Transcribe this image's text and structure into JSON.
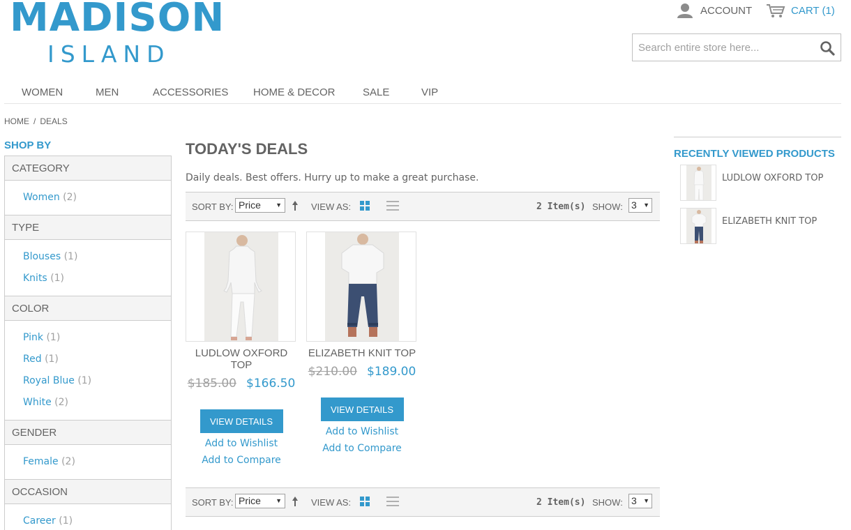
{
  "logo": {
    "main": "MADISON",
    "sub": "ISLAND"
  },
  "header": {
    "account_label": "ACCOUNT",
    "cart_label": "CART (1)",
    "search_placeholder": "Search entire store here..."
  },
  "nav": {
    "items": [
      {
        "label": "WOMEN"
      },
      {
        "label": "MEN"
      },
      {
        "label": "ACCESSORIES"
      },
      {
        "label": "HOME & DECOR"
      },
      {
        "label": "SALE"
      },
      {
        "label": "VIP"
      }
    ]
  },
  "breadcrumb": {
    "home": "HOME",
    "separator": "/",
    "current": "DEALS"
  },
  "sidebar": {
    "title": "SHOP BY",
    "filters": [
      {
        "heading": "CATEGORY",
        "options": [
          {
            "label": "Women",
            "count": "(2)"
          }
        ]
      },
      {
        "heading": "TYPE",
        "options": [
          {
            "label": "Blouses",
            "count": "(1)"
          },
          {
            "label": "Knits",
            "count": "(1)"
          }
        ]
      },
      {
        "heading": "COLOR",
        "options": [
          {
            "label": "Pink",
            "count": "(1)"
          },
          {
            "label": "Red",
            "count": "(1)"
          },
          {
            "label": "Royal Blue",
            "count": "(1)"
          },
          {
            "label": "White",
            "count": "(2)"
          }
        ]
      },
      {
        "heading": "GENDER",
        "options": [
          {
            "label": "Female",
            "count": "(2)"
          }
        ]
      },
      {
        "heading": "OCCASION",
        "options": [
          {
            "label": "Career",
            "count": "(1)"
          }
        ]
      }
    ]
  },
  "main": {
    "title": "TODAY'S DEALS",
    "description": "Daily deals. Best offers. Hurry up to make a great purchase."
  },
  "toolbar": {
    "sort_label": "SORT BY:",
    "sort_value": "Price",
    "view_label": "VIEW AS:",
    "item_count": "2 Item(s)",
    "show_label": "SHOW:",
    "show_value": "3"
  },
  "products": [
    {
      "name": "LUDLOW OXFORD TOP",
      "old_price": "$185.00",
      "new_price": "$166.50",
      "button": "VIEW DETAILS",
      "wishlist": "Add to Wishlist",
      "compare": "Add to Compare"
    },
    {
      "name": "ELIZABETH KNIT TOP",
      "old_price": "$210.00",
      "new_price": "$189.00",
      "button": "VIEW DETAILS",
      "wishlist": "Add to Wishlist",
      "compare": "Add to Compare"
    }
  ],
  "recent": {
    "title": "RECENTLY VIEWED PRODUCTS",
    "items": [
      {
        "name": "LUDLOW OXFORD TOP"
      },
      {
        "name": "ELIZABETH KNIT TOP"
      }
    ]
  },
  "colors": {
    "accent": "#3399cc",
    "text": "#636363",
    "muted": "#a0a0a0",
    "panel": "#f4f4f4"
  },
  "icons": {
    "account": "user-icon",
    "cart": "cart-icon",
    "search": "search-icon",
    "sort_direction": "arrow-up-icon",
    "grid": "grid-view-icon",
    "list": "list-view-icon"
  }
}
